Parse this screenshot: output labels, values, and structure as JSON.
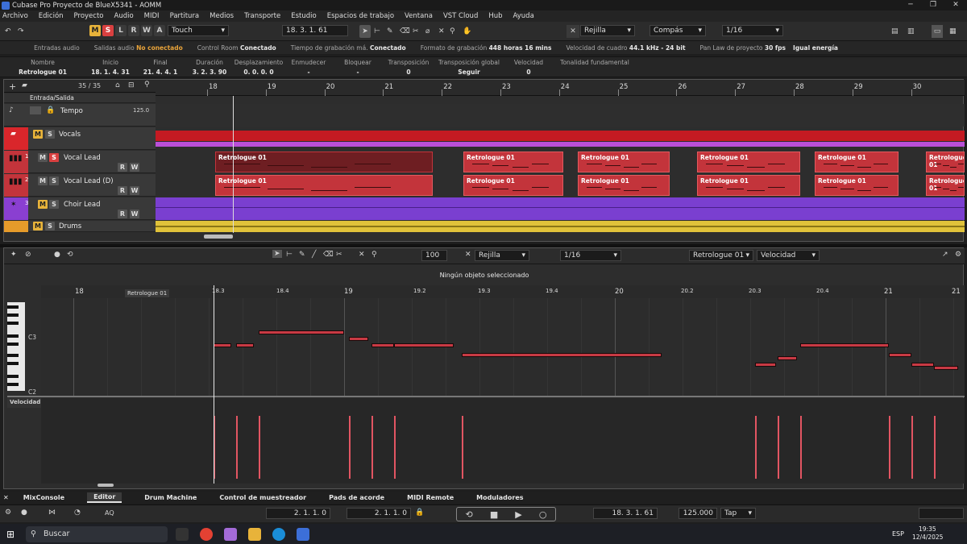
{
  "window": {
    "title": "Cubase Pro Proyecto de BlueX5341 - AOMM",
    "minimize": "─",
    "maximize": "❐",
    "close": "✕"
  },
  "menu": [
    "Archivo",
    "Edición",
    "Proyecto",
    "Audio",
    "MIDI",
    "Partitura",
    "Medios",
    "Transporte",
    "Estudio",
    "Espacios de trabajo",
    "Ventana",
    "VST Cloud",
    "Hub",
    "Ayuda"
  ],
  "toolbar": {
    "m": "M",
    "s": "S",
    "l": "L",
    "r": "R",
    "w": "W",
    "a": "A",
    "automation_mode": "Touch",
    "position": "18. 3. 1. 61",
    "snap_type": "Rejilla",
    "grid_type": "Compás",
    "quantize": "1/16"
  },
  "status": [
    {
      "label": "Entradas audio",
      "value": ""
    },
    {
      "label": "Salidas audio",
      "value": "No conectado",
      "warn": true
    },
    {
      "label": "Control Room",
      "value": "Conectado"
    },
    {
      "label": "Tiempo de grabación má.",
      "value": "Conectado"
    },
    {
      "label": "Formato de grabación",
      "value": "448 horas 16 mins"
    },
    {
      "label": "Velocidad de cuadro",
      "value": "44.1 kHz - 24 bit"
    },
    {
      "label": "Pan Law de proyecto",
      "value": "30 fps"
    },
    {
      "label": "",
      "value": "Igual energía"
    }
  ],
  "info": [
    {
      "label": "Nombre",
      "value": "Retrologue 01"
    },
    {
      "label": "Inicio",
      "value": "18. 1. 4. 31"
    },
    {
      "label": "Final",
      "value": "21. 4. 4. 1"
    },
    {
      "label": "Duración",
      "value": "3. 2. 3. 90"
    },
    {
      "label": "Desplazamiento",
      "value": "0. 0. 0. 0"
    },
    {
      "label": "Enmudecer",
      "value": "-"
    },
    {
      "label": "Bloquear",
      "value": "-"
    },
    {
      "label": "Transposición",
      "value": "0"
    },
    {
      "label": "Transposición global",
      "value": "Seguir"
    },
    {
      "label": "Velocidad",
      "value": "0"
    },
    {
      "label": "Tonalidad fundamental",
      "value": ""
    }
  ],
  "project": {
    "track_count": "35 / 35",
    "bars": [
      "18",
      "19",
      "20",
      "21",
      "22",
      "23",
      "24",
      "25",
      "26",
      "27",
      "28",
      "29",
      "30"
    ],
    "tracks": [
      {
        "num": "",
        "name": "Entrada/Salida"
      },
      {
        "num": "",
        "name": "Tempo",
        "tempo": "125.0"
      },
      {
        "num": "",
        "name": "Vocals"
      },
      {
        "num": "1",
        "name": "Vocal Lead"
      },
      {
        "num": "2",
        "name": "Vocal Lead (D)"
      },
      {
        "num": "3",
        "name": "Choir Lead"
      },
      {
        "num": "",
        "name": "Drums"
      }
    ],
    "clip_name": "Retrologue 01"
  },
  "editor": {
    "message": "Ningún objeto seleccionado",
    "quantize_value": "100",
    "snap": "Rejilla",
    "quantize": "1/16",
    "part": "Retrologue 01",
    "lane": "Velocidad",
    "ruler": [
      "18",
      "18.3",
      "18.4",
      "19",
      "19.2",
      "19.3",
      "19.4",
      "20",
      "20.2",
      "20.3",
      "20.4",
      "21",
      "21"
    ],
    "part_label": "Retrologue 01",
    "c3": "C3",
    "c2": "C2",
    "vel_label": "Velocidad"
  },
  "dock": [
    "MixConsole",
    "Editor",
    "Drum Machine",
    "Control de muestreador",
    "Pads de acorde",
    "MIDI Remote",
    "Moduladores"
  ],
  "transport": {
    "left_locator": "2. 1. 1. 0",
    "right_locator": "2. 1. 1. 0",
    "position": "18. 3. 1. 61",
    "tempo": "125.000",
    "tap": "Tap"
  },
  "taskbar": {
    "search": "Buscar",
    "lang": "ESP",
    "time": "19:35",
    "date": "12/4/2025"
  }
}
